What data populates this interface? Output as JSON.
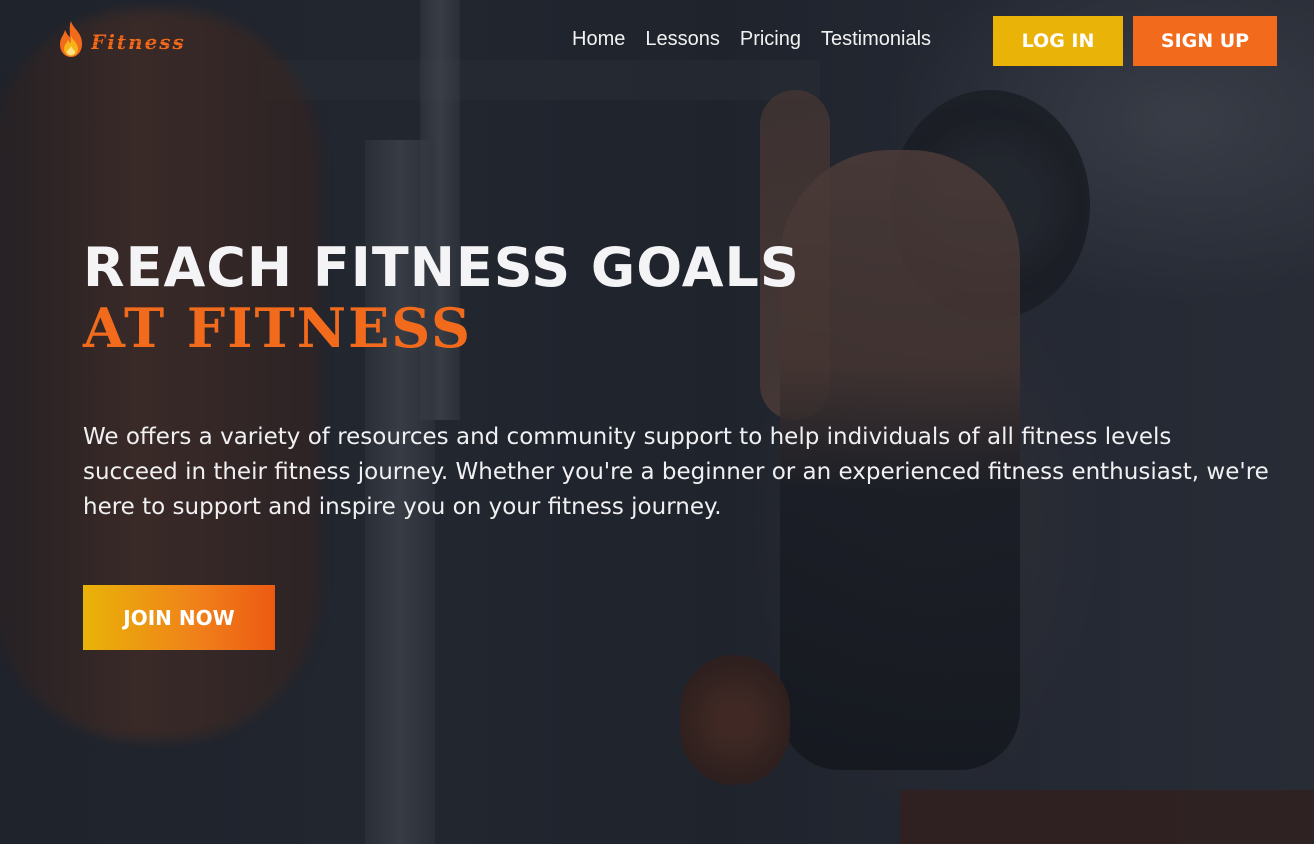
{
  "brand": {
    "logo_text": "Fitness",
    "logo_icon": "flame-icon",
    "accent_orange": "#f26b1d",
    "accent_yellow": "#e9b308"
  },
  "nav": {
    "items": [
      {
        "label": "Home"
      },
      {
        "label": "Lessons"
      },
      {
        "label": "Pricing"
      },
      {
        "label": "Testimonials"
      }
    ]
  },
  "auth": {
    "login_label": "LOG IN",
    "signup_label": "SIGN UP"
  },
  "hero": {
    "headline_line1": "REACH FITNESS GOALS",
    "headline_line2": "AT FITNESS",
    "description": "We offers a variety of resources and community support to help individuals of all fitness levels succeed in their fitness journey. Whether you're a beginner or an experienced fitness enthusiast, we're here to support and inspire you on your fitness journey.",
    "cta_label": "JOIN NOW"
  }
}
